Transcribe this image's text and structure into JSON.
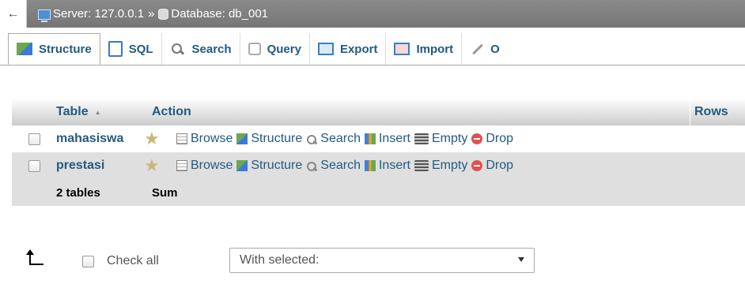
{
  "breadcrumb": {
    "back_glyph": "←",
    "server_label": "Server: 127.0.0.1",
    "separator": "»",
    "database_label": "Database: db_001"
  },
  "tabs": [
    {
      "label": "Structure",
      "icon": "structure-icon",
      "active": true
    },
    {
      "label": "SQL",
      "icon": "sql-icon"
    },
    {
      "label": "Search",
      "icon": "search-icon"
    },
    {
      "label": "Query",
      "icon": "query-icon"
    },
    {
      "label": "Export",
      "icon": "export-icon"
    },
    {
      "label": "Import",
      "icon": "import-icon"
    },
    {
      "label": "O",
      "icon": "wrench-icon"
    }
  ],
  "table": {
    "headers": {
      "table": "Table",
      "action": "Action",
      "rows": "Rows"
    },
    "rows": [
      {
        "name": "mahasiswa"
      },
      {
        "name": "prestasi"
      }
    ],
    "actions": {
      "browse": "Browse",
      "structure": "Structure",
      "search": "Search",
      "insert": "Insert",
      "empty": "Empty",
      "drop": "Drop"
    },
    "footer": {
      "count": "2 tables",
      "sum": "Sum"
    }
  },
  "bottom": {
    "check_all": "Check all",
    "with_selected": "With selected:"
  },
  "colors": {
    "link": "#235a81",
    "topbar": "#7f7f7f",
    "row_alt": "#dfdfdf"
  }
}
